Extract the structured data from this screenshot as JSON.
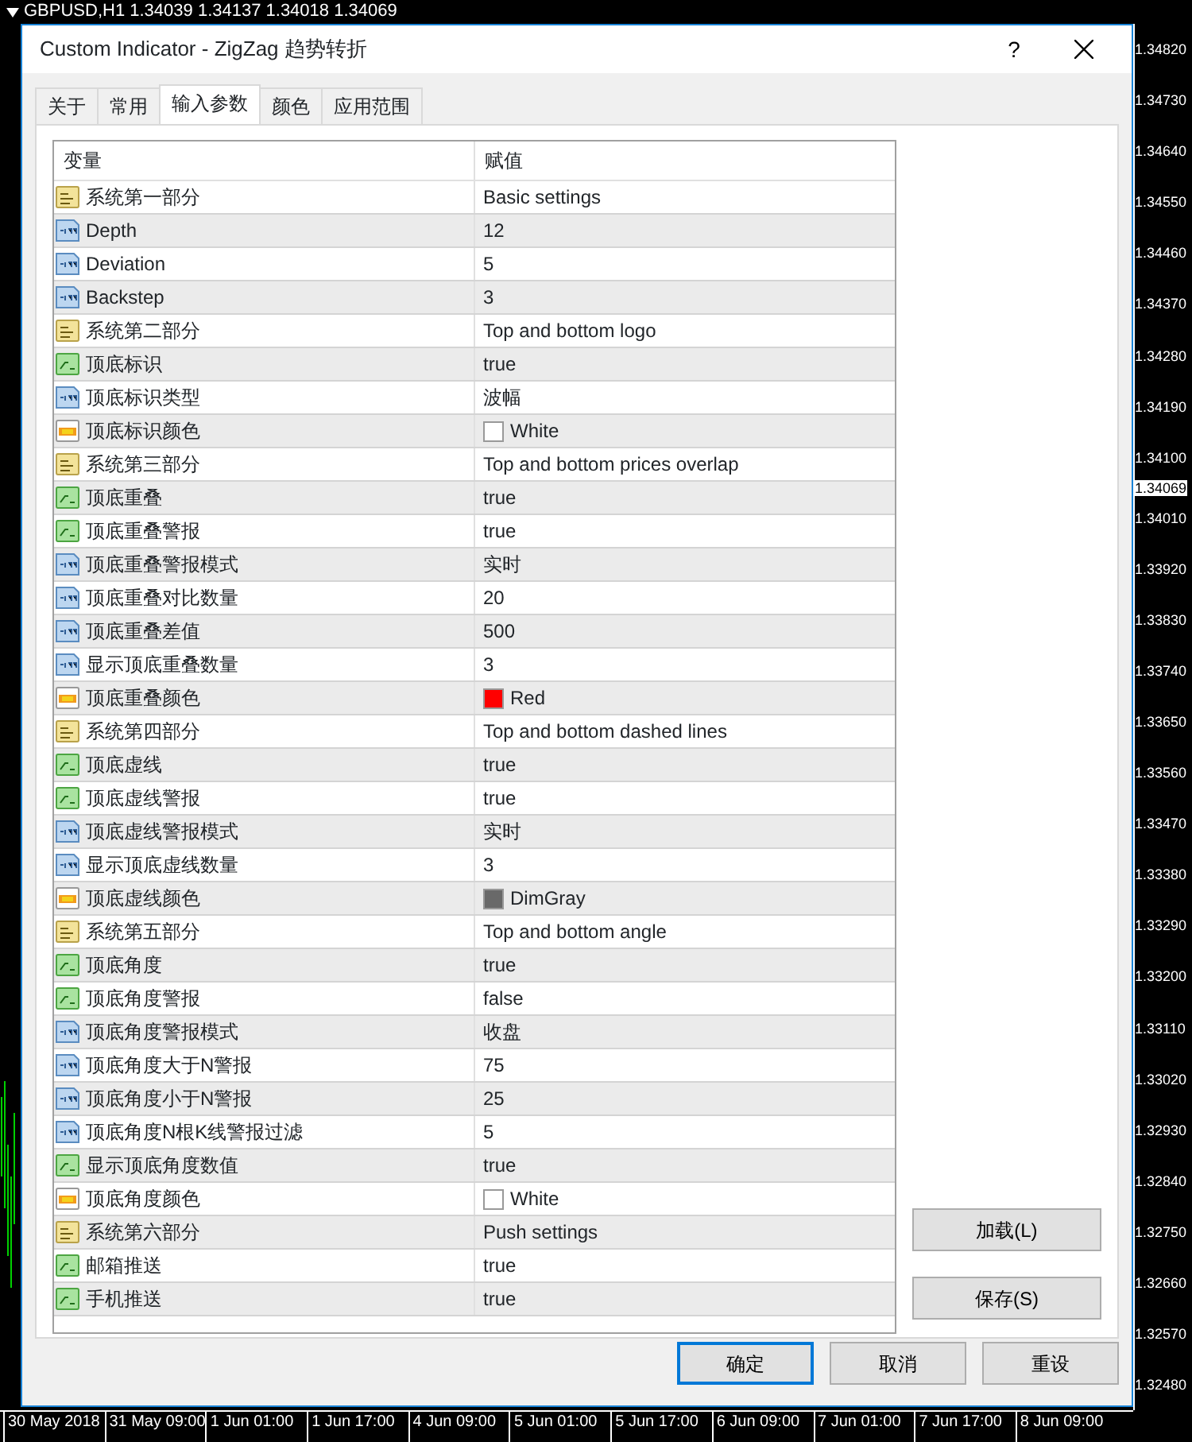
{
  "chart": {
    "symbol_line": "GBPUSD,H1  1.34039 1.34137 1.34018 1.34069",
    "price_axis": [
      {
        "text": "1.34820",
        "current": false
      },
      {
        "text": "1.34730",
        "current": false
      },
      {
        "text": "1.34640",
        "current": false
      },
      {
        "text": "1.34550",
        "current": false
      },
      {
        "text": "1.34460",
        "current": false
      },
      {
        "text": "1.34370",
        "current": false
      },
      {
        "text": "1.34280",
        "current": false
      },
      {
        "text": "1.34190",
        "current": false
      },
      {
        "text": "1.34100",
        "current": false
      },
      {
        "text": "1.34069",
        "current": true
      },
      {
        "text": "1.34010",
        "current": false
      },
      {
        "text": "1.33920",
        "current": false
      },
      {
        "text": "1.33830",
        "current": false
      },
      {
        "text": "1.33740",
        "current": false
      },
      {
        "text": "1.33650",
        "current": false
      },
      {
        "text": "1.33560",
        "current": false
      },
      {
        "text": "1.33470",
        "current": false
      },
      {
        "text": "1.33380",
        "current": false
      },
      {
        "text": "1.33290",
        "current": false
      },
      {
        "text": "1.33200",
        "current": false
      },
      {
        "text": "1.33110",
        "current": false
      },
      {
        "text": "1.33020",
        "current": false
      },
      {
        "text": "1.32930",
        "current": false
      },
      {
        "text": "1.32840",
        "current": false
      },
      {
        "text": "1.32750",
        "current": false
      },
      {
        "text": "1.32660",
        "current": false
      },
      {
        "text": "1.32570",
        "current": false
      },
      {
        "text": "1.32480",
        "current": false
      }
    ],
    "time_axis": [
      "30 May 2018",
      "31 May 09:00",
      "1 Jun 01:00",
      "1 Jun 17:00",
      "4 Jun 09:00",
      "5 Jun 01:00",
      "5 Jun 17:00",
      "6 Jun 09:00",
      "7 Jun 01:00",
      "7 Jun 17:00",
      "8 Jun 09:00"
    ]
  },
  "dialog": {
    "title": "Custom Indicator - ZigZag 趋势转折",
    "help": "?",
    "tabs": [
      {
        "label": "关于",
        "selected": false
      },
      {
        "label": "常用",
        "selected": false
      },
      {
        "label": "输入参数",
        "selected": true
      },
      {
        "label": "颜色",
        "selected": false
      },
      {
        "label": "应用范围",
        "selected": false
      }
    ],
    "table": {
      "columns": [
        "变量",
        "赋值"
      ],
      "rows": [
        {
          "kind": "string",
          "name": "系统第一部分",
          "value": "Basic settings"
        },
        {
          "kind": "int",
          "name": "Depth",
          "value": "12"
        },
        {
          "kind": "int",
          "name": "Deviation",
          "value": "5"
        },
        {
          "kind": "int",
          "name": "Backstep",
          "value": "3"
        },
        {
          "kind": "string",
          "name": "系统第二部分",
          "value": "Top and bottom logo"
        },
        {
          "kind": "bool",
          "name": "顶底标识",
          "value": "true"
        },
        {
          "kind": "int",
          "name": "顶底标识类型",
          "value": "波幅"
        },
        {
          "kind": "color",
          "name": "顶底标识颜色",
          "value": "White",
          "color": "#ffffff"
        },
        {
          "kind": "string",
          "name": "系统第三部分",
          "value": "Top and bottom prices overlap"
        },
        {
          "kind": "bool",
          "name": "顶底重叠",
          "value": "true"
        },
        {
          "kind": "bool",
          "name": "顶底重叠警报",
          "value": "true"
        },
        {
          "kind": "int",
          "name": "顶底重叠警报模式",
          "value": "实时"
        },
        {
          "kind": "int",
          "name": "顶底重叠对比数量",
          "value": "20"
        },
        {
          "kind": "int",
          "name": "顶底重叠差值",
          "value": "500"
        },
        {
          "kind": "int",
          "name": "显示顶底重叠数量",
          "value": "3"
        },
        {
          "kind": "color",
          "name": "顶底重叠颜色",
          "value": "Red",
          "color": "#ff0000"
        },
        {
          "kind": "string",
          "name": "系统第四部分",
          "value": "Top and bottom dashed lines"
        },
        {
          "kind": "bool",
          "name": "顶底虚线",
          "value": "true"
        },
        {
          "kind": "bool",
          "name": "顶底虚线警报",
          "value": "true"
        },
        {
          "kind": "int",
          "name": "顶底虚线警报模式",
          "value": "实时"
        },
        {
          "kind": "int",
          "name": "显示顶底虚线数量",
          "value": "3"
        },
        {
          "kind": "color",
          "name": "顶底虚线颜色",
          "value": "DimGray",
          "color": "#696969"
        },
        {
          "kind": "string",
          "name": "系统第五部分",
          "value": "Top and bottom angle"
        },
        {
          "kind": "bool",
          "name": "顶底角度",
          "value": "true"
        },
        {
          "kind": "bool",
          "name": "顶底角度警报",
          "value": "false"
        },
        {
          "kind": "int",
          "name": "顶底角度警报模式",
          "value": "收盘"
        },
        {
          "kind": "int",
          "name": "顶底角度大于N警报",
          "value": "75"
        },
        {
          "kind": "int",
          "name": "顶底角度小于N警报",
          "value": "25"
        },
        {
          "kind": "int",
          "name": "顶底角度N根K线警报过滤",
          "value": "5"
        },
        {
          "kind": "bool",
          "name": "显示顶底角度数值",
          "value": "true"
        },
        {
          "kind": "color",
          "name": "顶底角度颜色",
          "value": "White",
          "color": "#ffffff"
        },
        {
          "kind": "string",
          "name": "系统第六部分",
          "value": "Push settings"
        },
        {
          "kind": "bool",
          "name": "邮箱推送",
          "value": "true"
        },
        {
          "kind": "bool",
          "name": "手机推送",
          "value": "true"
        }
      ]
    },
    "side_buttons": [
      "加载(L)",
      "保存(S)"
    ],
    "buttons": [
      {
        "label": "确定",
        "default": true
      },
      {
        "label": "取消",
        "default": false
      },
      {
        "label": "重设",
        "default": false
      }
    ]
  }
}
